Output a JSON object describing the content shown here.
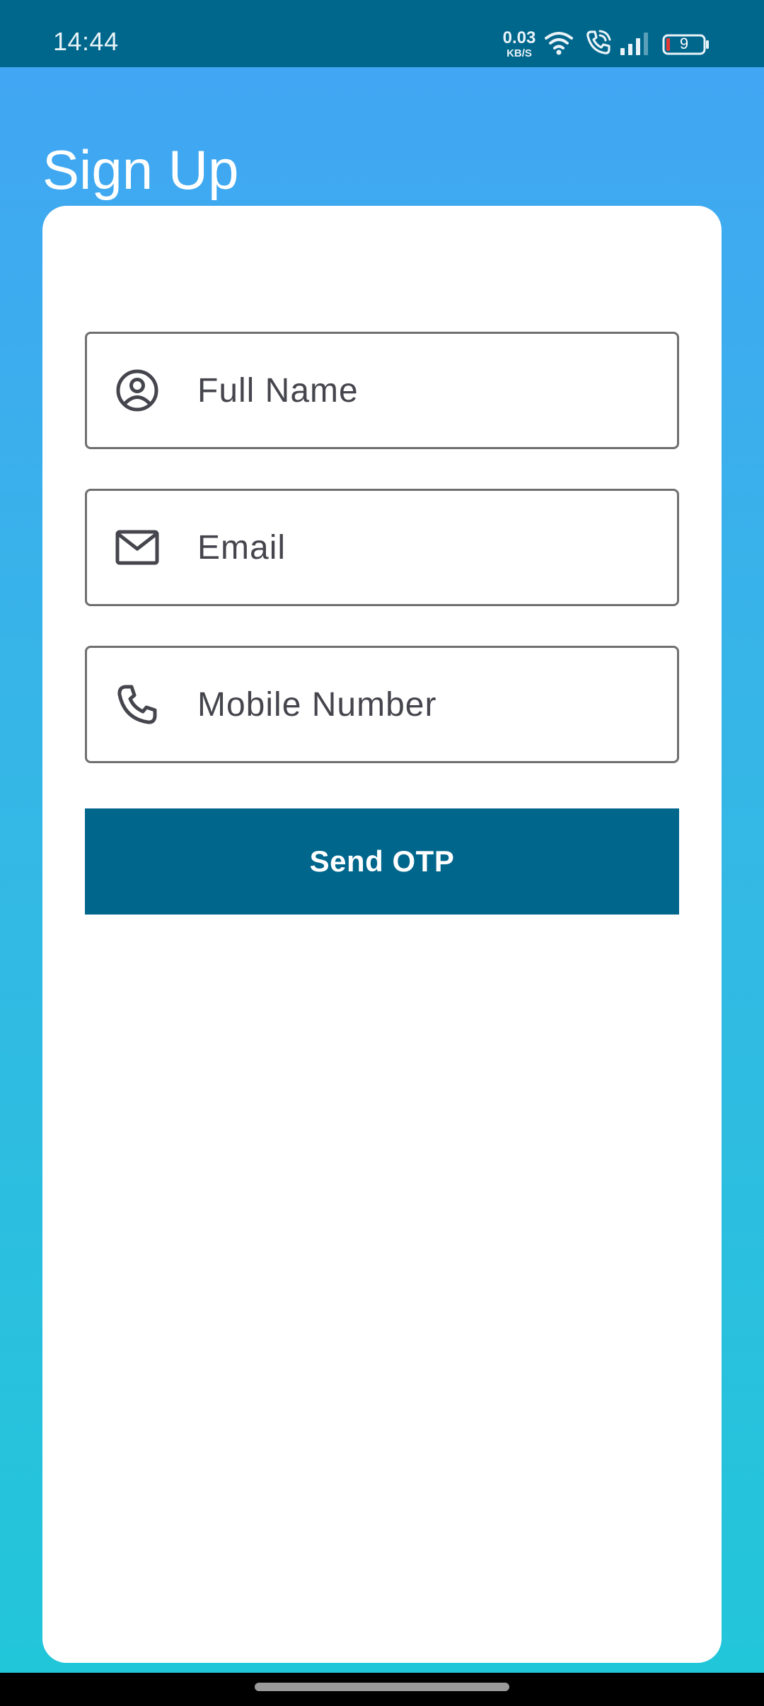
{
  "status_bar": {
    "time": "14:44",
    "net_speed_value": "0.03",
    "net_speed_unit": "KB/S",
    "battery_level": "9",
    "icons": [
      "wifi-icon",
      "call-icon",
      "signal-icon",
      "battery-icon"
    ]
  },
  "page": {
    "title": "Sign Up"
  },
  "form": {
    "full_name": {
      "placeholder": "Full Name",
      "value": "",
      "icon": "user-circle-icon"
    },
    "email": {
      "placeholder": "Email",
      "value": "",
      "icon": "mail-icon"
    },
    "mobile": {
      "placeholder": "Mobile Number",
      "value": "",
      "icon": "phone-icon"
    },
    "submit_label": "Send OTP"
  },
  "colors": {
    "status_bar": "#00678c",
    "gradient_top": "#41a6f3",
    "gradient_bottom": "#22c6d9",
    "button": "#00668c",
    "card": "#ffffff",
    "field_border": "#6f6f6f",
    "icon_text": "#45454d"
  }
}
